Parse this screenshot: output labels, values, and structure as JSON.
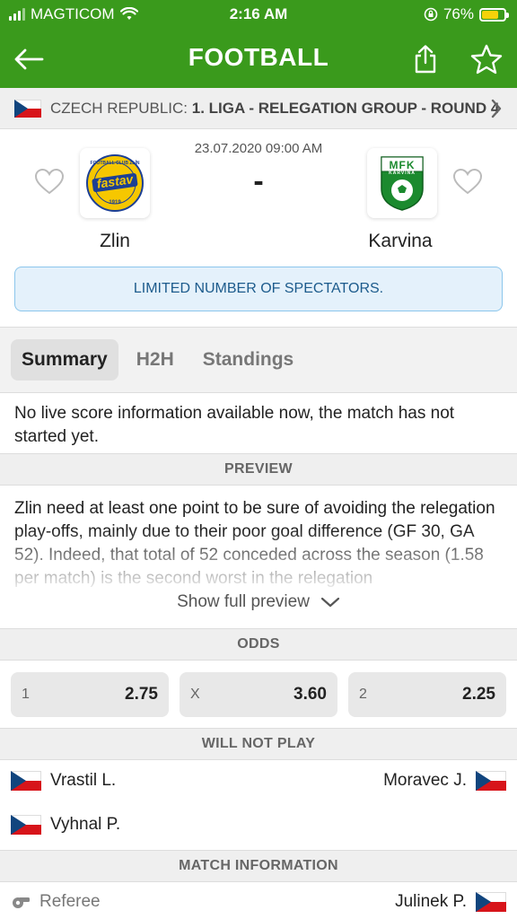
{
  "status_bar": {
    "carrier": "MAGTICOM",
    "time": "2:16 AM",
    "battery": "76%",
    "battery_level": 0.76
  },
  "header": {
    "title": "FOOTBALL",
    "back_icon": "arrow-left-icon",
    "share_icon": "share-icon",
    "favorite_icon": "star-icon"
  },
  "league": {
    "country": "CZECH REPUBLIC: ",
    "competition": "1. LIGA - RELEGATION GROUP - ROUND 4",
    "flag": "czech-flag-icon"
  },
  "match": {
    "datetime": "23.07.2020 09:00 AM",
    "score": "-",
    "home": {
      "name": "Zlin",
      "logo_text_top": "FOOTBALL CLUB ZLÍN",
      "logo_text": "fastav",
      "logo_year": "1919"
    },
    "away": {
      "name": "Karvina",
      "logo_text": "MFK",
      "logo_sub": "KARVINÁ"
    },
    "notice": "LIMITED NUMBER OF SPECTATORS."
  },
  "tabs": [
    {
      "label": "Summary",
      "active": true
    },
    {
      "label": "H2H",
      "active": false
    },
    {
      "label": "Standings",
      "active": false
    }
  ],
  "live_info": "No live score information available now, the match has not started yet.",
  "preview": {
    "heading": "PREVIEW",
    "text": "Zlin need at least one point to be sure of avoiding the relegation play-offs, mainly due to their poor goal difference (GF 30, GA 52). Indeed, that total of 52 conceded across the season (1.58 per match) is the second worst in the relegation",
    "show_more": "Show full preview"
  },
  "odds": {
    "heading": "ODDS",
    "items": [
      {
        "key": "1",
        "value": "2.75"
      },
      {
        "key": "X",
        "value": "3.60"
      },
      {
        "key": "2",
        "value": "2.25"
      }
    ]
  },
  "will_not_play": {
    "heading": "WILL NOT PLAY",
    "home": [
      "Vrastil L.",
      "Vyhnal P."
    ],
    "away": [
      "Moravec J."
    ]
  },
  "match_information": {
    "heading": "MATCH INFORMATION",
    "referee_label": "Referee",
    "referee_name": "Julinek P."
  },
  "colors": {
    "brand_green": "#3a9a1c",
    "zlin_yellow": "#f6c700",
    "karvina_green": "#1b8a2e",
    "notice_bg": "#e4f1fb"
  }
}
